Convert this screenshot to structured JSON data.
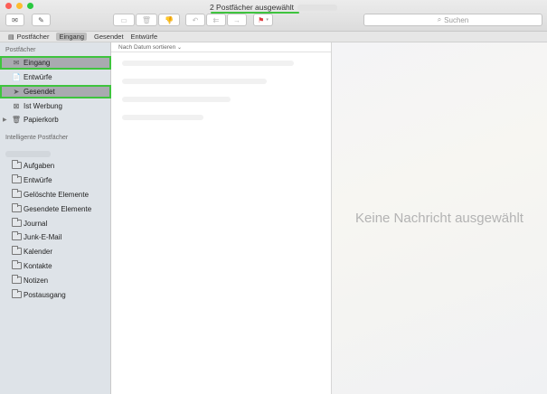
{
  "window": {
    "title": "2 Postfächer ausgewählt"
  },
  "toolbar": {
    "get_mail_icon": "envelope-icon",
    "compose_icon": "compose-icon",
    "archive_icon": "archive-icon",
    "delete_icon": "trash-icon",
    "junk_icon": "thumbs-down-icon",
    "reply_icon": "reply-icon",
    "reply_all_icon": "reply-all-icon",
    "forward_icon": "forward-icon",
    "flag_icon": "flag-icon",
    "search_placeholder": "Suchen",
    "accent_flag": "#e0393e"
  },
  "favorites": {
    "toggle_label": "Postfächer",
    "items": [
      "Eingang",
      "Gesendet",
      "Entwürfe"
    ]
  },
  "sidebar": {
    "mailboxes_header": "Postfächer",
    "mailboxes": [
      {
        "label": "Eingang",
        "icon": "inbox-icon"
      },
      {
        "label": "Entwürfe",
        "icon": "draft-icon"
      },
      {
        "label": "Gesendet",
        "icon": "sent-icon"
      },
      {
        "label": "Ist Werbung",
        "icon": "junk-icon"
      },
      {
        "label": "Papierkorb",
        "icon": "trash-icon"
      }
    ],
    "smart_header": "Intelligente Postfächer",
    "folders": [
      "Aufgaben",
      "Entwürfe",
      "Gelöschte Elemente",
      "Gesendete Elemente",
      "Journal",
      "Junk-E-Mail",
      "Kalender",
      "Kontakte",
      "Notizen",
      "Postausgang"
    ],
    "highlight_color": "#3ec43e"
  },
  "list": {
    "sort_label": "Nach Datum sortieren"
  },
  "viewer": {
    "empty_message": "Keine Nachricht ausgewählt"
  }
}
